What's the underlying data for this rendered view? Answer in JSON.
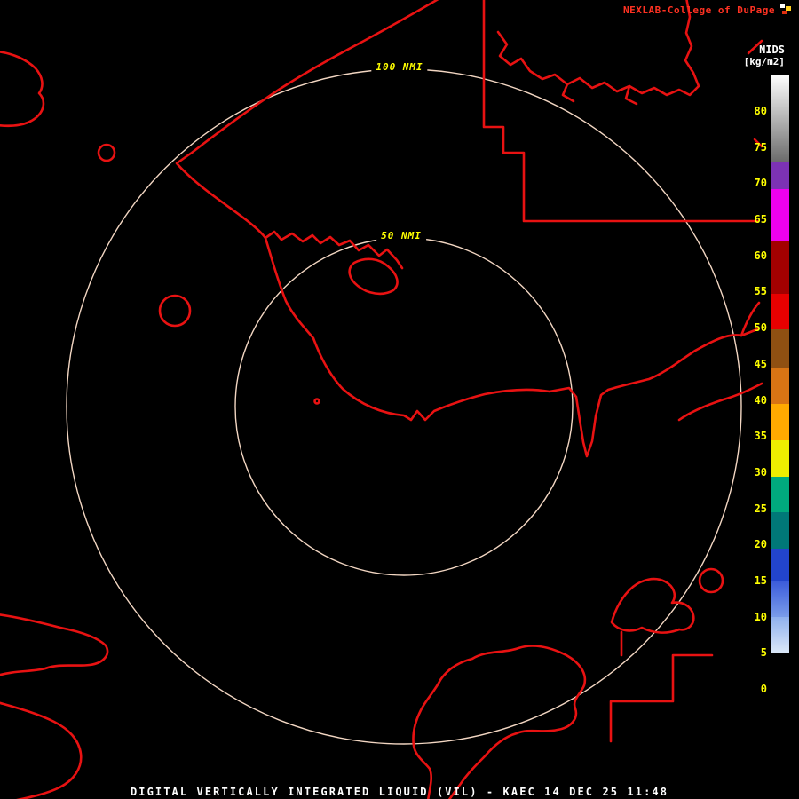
{
  "header": {
    "brand": "NEXLAB-College of DuPage"
  },
  "legend": {
    "product": "NIDS",
    "units": "[kg/m2]",
    "ticks": [
      80,
      75,
      70,
      65,
      60,
      55,
      50,
      45,
      40,
      35,
      30,
      25,
      20,
      15,
      10,
      5,
      0
    ],
    "segments": [
      {
        "from": -2,
        "to": 5,
        "color": "#000000"
      },
      {
        "from": 5,
        "to": 10,
        "color": "#dde9f8",
        "color_top": "#8fb0ee"
      },
      {
        "from": 10,
        "to": 15,
        "color": "#7a9cea",
        "color_top": "#3a5ada"
      },
      {
        "from": 15,
        "to": 19.5,
        "color": "#2244cc"
      },
      {
        "from": 19.5,
        "to": 24.5,
        "color": "#007878"
      },
      {
        "from": 24.5,
        "to": 29.5,
        "color": "#00aa7e"
      },
      {
        "from": 29.5,
        "to": 34.5,
        "color": "#eeee00"
      },
      {
        "from": 34.5,
        "to": 39.5,
        "color": "#ffaa00"
      },
      {
        "from": 39.5,
        "to": 44.5,
        "color": "#d87414"
      },
      {
        "from": 44.5,
        "to": 49.8,
        "color": "#8f5012"
      },
      {
        "from": 49.8,
        "to": 54.8,
        "color": "#e80000"
      },
      {
        "from": 54.8,
        "to": 62,
        "color": "#a30000"
      },
      {
        "from": 62,
        "to": 69.3,
        "color": "#ee00ee"
      },
      {
        "from": 69.3,
        "to": 73,
        "color": "#7c32b4"
      },
      {
        "from": 73,
        "to": 85,
        "color": "#6a6a6a",
        "color_top": "#ffffff"
      }
    ]
  },
  "range_rings": {
    "inner_label": "50 NMI",
    "outer_label": "100 NMI"
  },
  "status_bar": {
    "text": "DIGITAL VERTICALLY INTEGRATED LIQUID (VIL) - KAEC 14 DEC 25 11:48"
  },
  "colors": {
    "background": "#000000",
    "map_outline": "#e81212",
    "range_ring": "#f2d6c2",
    "ring_label": "#ffff00",
    "tick_label": "#ffff00",
    "brand_text": "#ff3222",
    "legend_text": "#ffffff",
    "status_text": "#ffffff"
  }
}
